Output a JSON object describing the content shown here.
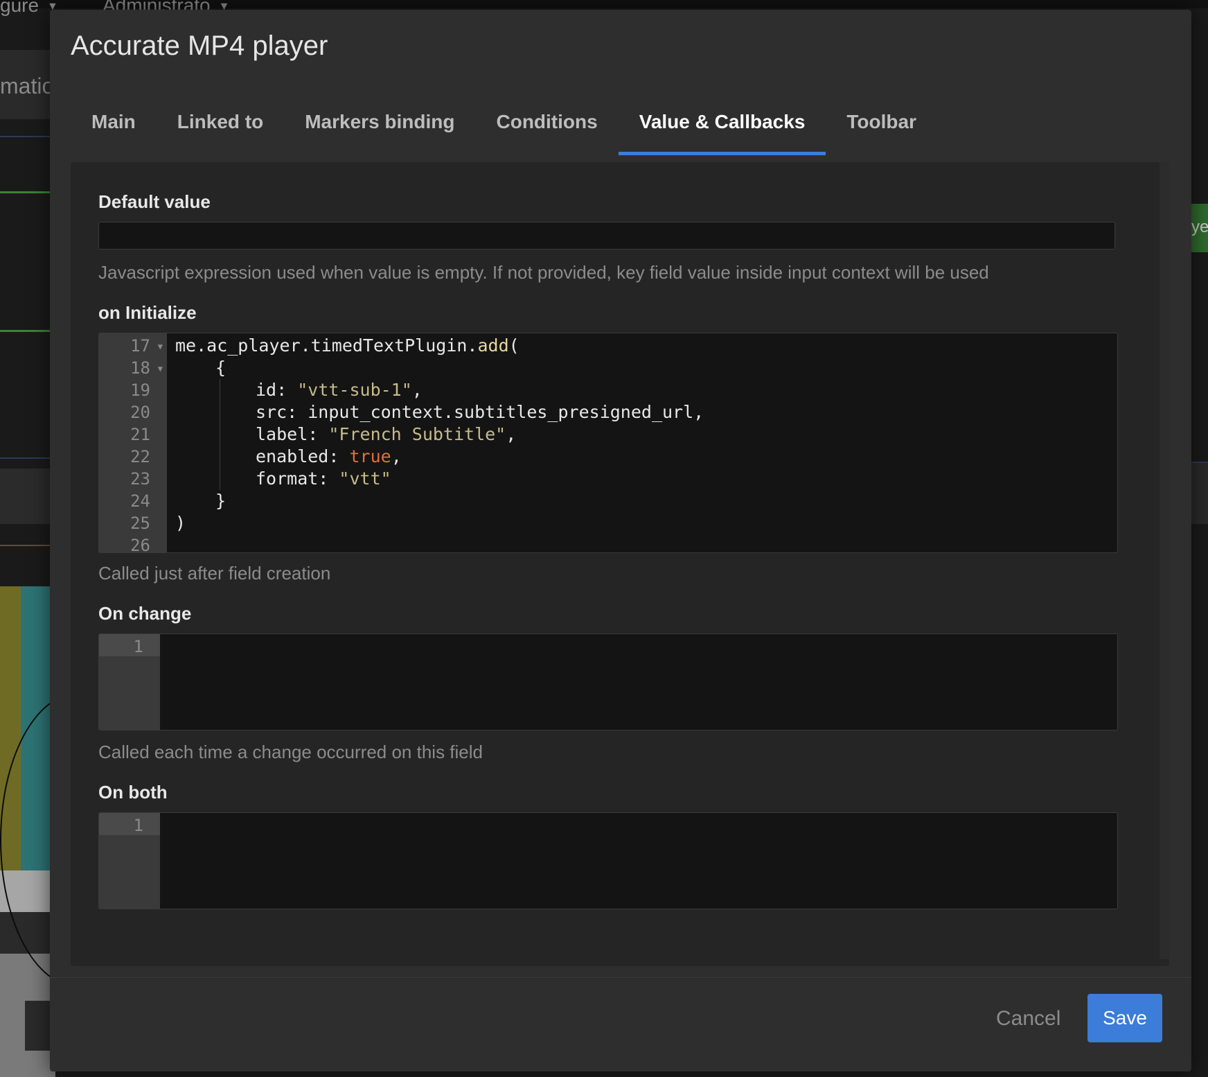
{
  "background": {
    "menu_1": "gure",
    "menu_2": "Administrato",
    "side_text": "matio",
    "right_tab_text": "ye"
  },
  "modal": {
    "title": "Accurate MP4 player",
    "tabs": [
      {
        "label": "Main",
        "active": false
      },
      {
        "label": "Linked to",
        "active": false
      },
      {
        "label": "Markers binding",
        "active": false
      },
      {
        "label": "Conditions",
        "active": false
      },
      {
        "label": "Value & Callbacks",
        "active": true
      },
      {
        "label": "Toolbar",
        "active": false
      }
    ],
    "default_value": {
      "label": "Default value",
      "value": "",
      "help": "Javascript expression used when value is empty. If not provided, key field value inside input context will be used"
    },
    "on_initialize": {
      "label": "on Initialize",
      "line_numbers": [
        "17",
        "18",
        "19",
        "20",
        "21",
        "22",
        "23",
        "24",
        "25",
        "26"
      ],
      "code": {
        "l17_obj": "me.ac_player.timedTextPlugin.",
        "l17_fn": "add",
        "l17_paren": "(",
        "l18": "{",
        "l19_key": "id: ",
        "l19_val": "\"vtt-sub-1\"",
        "l19_end": ",",
        "l20": "src: input_context.subtitles_presigned_url,",
        "l21_key": "label: ",
        "l21_val": "\"French Subtitle\"",
        "l21_end": ",",
        "l22_key": "enabled: ",
        "l22_val": "true",
        "l22_end": ",",
        "l23_key": "format: ",
        "l23_val": "\"vtt\"",
        "l24": "}",
        "l25": ")"
      },
      "help": "Called just after field creation"
    },
    "on_change": {
      "label": "On change",
      "line_number": "1",
      "help": "Called each time a change occurred on this field"
    },
    "on_both": {
      "label": "On both",
      "line_number": "1"
    },
    "footer": {
      "cancel_label": "Cancel",
      "save_label": "Save"
    },
    "colors": {
      "accent": "#3b7dd8",
      "string": "#c8bb8a",
      "boolean": "#e0703f",
      "function": "#e6d99a"
    }
  }
}
